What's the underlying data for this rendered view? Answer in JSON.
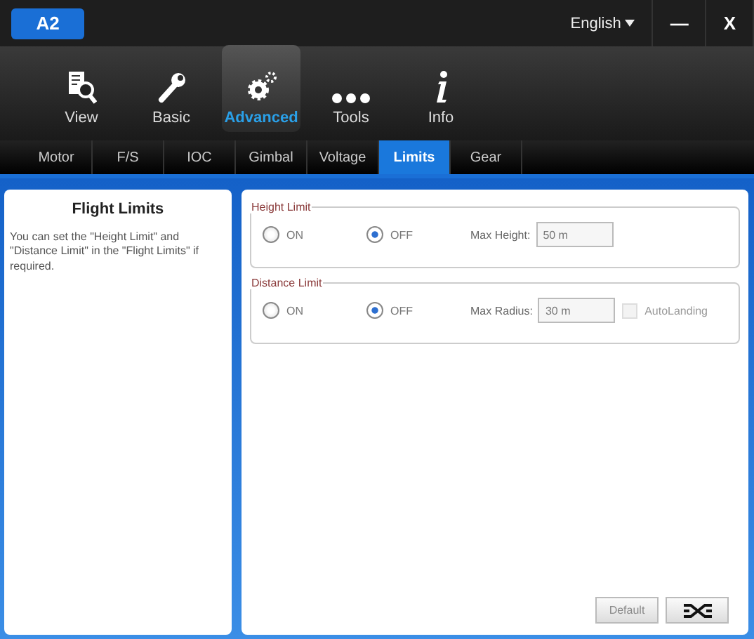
{
  "app_badge": "A2",
  "language": {
    "label": "English"
  },
  "minimize": {
    "label": "—"
  },
  "close": {
    "label": "X"
  },
  "toolbar": [
    {
      "label": "View",
      "kind": "view",
      "selected": false
    },
    {
      "label": "Basic",
      "kind": "wrench",
      "selected": false
    },
    {
      "label": "Advanced",
      "kind": "gears",
      "selected": true
    },
    {
      "label": "Tools",
      "kind": "dots",
      "selected": false
    },
    {
      "label": "Info",
      "kind": "info",
      "selected": false
    }
  ],
  "tabs": [
    {
      "label": "Motor",
      "selected": false
    },
    {
      "label": "F/S",
      "selected": false
    },
    {
      "label": "IOC",
      "selected": false
    },
    {
      "label": "Gimbal",
      "selected": false
    },
    {
      "label": "Voltage",
      "selected": false
    },
    {
      "label": "Limits",
      "selected": true
    },
    {
      "label": "Gear",
      "selected": false
    }
  ],
  "help": {
    "title": "Flight Limits",
    "text": "You can set the \"Height Limit\" and \"Distance Limit\" in the \"Flight Limits\" if required."
  },
  "groups": [
    {
      "title": "Height Limit",
      "options": [
        {
          "label": "ON",
          "selected": false
        },
        {
          "label": "OFF",
          "selected": true
        }
      ],
      "field_label": "Max Height:",
      "field_value": "50 m"
    },
    {
      "title": "Distance Limit",
      "options": [
        {
          "label": "ON",
          "selected": false
        },
        {
          "label": "OFF",
          "selected": true
        }
      ],
      "field_label": "Max Radius:",
      "field_value": "30 m",
      "checkbox": {
        "label": "AutoLanding",
        "checked": false,
        "disabled": true
      }
    }
  ],
  "buttons": [
    {
      "kind": "text",
      "label": "Default"
    },
    {
      "kind": "icon"
    }
  ]
}
